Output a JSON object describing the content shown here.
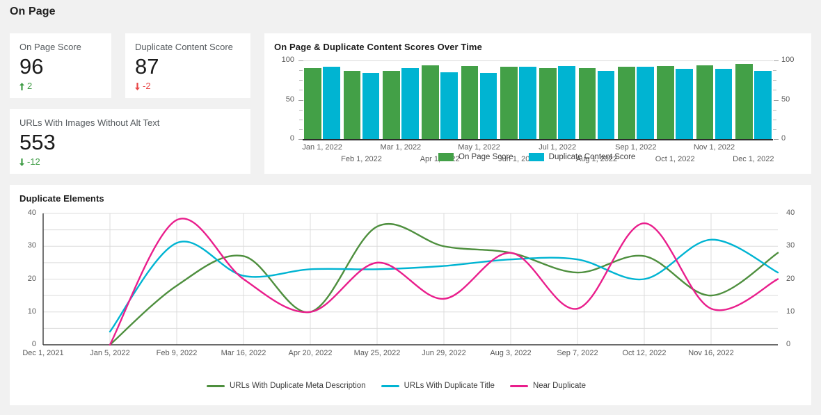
{
  "header": {
    "title": "On Page"
  },
  "kpis": [
    {
      "label": "On Page Score",
      "value": "96",
      "delta": "2",
      "direction": "up",
      "color": "#3f9c46"
    },
    {
      "label": "Duplicate Content Score",
      "value": "87",
      "delta": "-2",
      "direction": "down",
      "color": "#e84545"
    },
    {
      "label": "URLs With Images Without Alt Text",
      "value": "553",
      "delta": "-12",
      "direction": "down",
      "color": "#3f9c46"
    }
  ],
  "bar_panel": {
    "title": "On Page & Duplicate Content Scores Over Time"
  },
  "line_panel": {
    "title": "Duplicate Elements"
  },
  "chart_data": [
    {
      "type": "bar",
      "title": "On Page & Duplicate Content Scores Over Time",
      "xlabel": "",
      "ylabel": "",
      "ylim": [
        0,
        100
      ],
      "yticks": [
        0,
        50,
        100
      ],
      "dual_axis": true,
      "grid": true,
      "legend_position": "bottom",
      "categories": [
        "Jan 1, 2022",
        "Feb 1, 2022",
        "Mar 1, 2022",
        "Apr 1, 2022",
        "May 1, 2022",
        "Jun 1, 2022",
        "Jul 1, 2022",
        "Aug 1, 2022",
        "Sep 1, 2022",
        "Oct 1, 2022",
        "Nov 1, 2022",
        "Dec 1, 2022"
      ],
      "series": [
        {
          "name": "On Page Score",
          "color": "#43a047",
          "values": [
            90,
            87,
            87,
            94,
            93,
            92,
            90,
            90,
            92,
            93,
            94,
            96
          ]
        },
        {
          "name": "Duplicate Content Score",
          "color": "#00b4d2",
          "values": [
            92,
            84,
            90,
            85,
            84,
            92,
            93,
            87,
            92,
            89,
            89,
            87
          ]
        }
      ]
    },
    {
      "type": "line",
      "title": "Duplicate Elements",
      "xlabel": "",
      "ylabel": "",
      "ylim": [
        0,
        40
      ],
      "yticks": [
        0,
        10,
        20,
        30,
        40
      ],
      "dual_axis": true,
      "grid": true,
      "legend_position": "bottom",
      "x": [
        "Dec 1, 2021",
        "Jan 5, 2022",
        "Feb 9, 2022",
        "Mar 16, 2022",
        "Apr 20, 2022",
        "May 25, 2022",
        "Jun 29, 2022",
        "Aug 3, 2022",
        "Sep 7, 2022",
        "Oct 12, 2022",
        "Nov 16, 2022"
      ],
      "series": [
        {
          "name": "URLs With Duplicate Meta Description",
          "color": "#4e8f3e",
          "values": [
            null,
            0,
            18,
            27,
            10,
            36,
            30,
            28,
            22,
            27,
            15,
            28
          ]
        },
        {
          "name": "URLs With Duplicate Title",
          "color": "#00b4d2",
          "values": [
            null,
            4,
            31,
            21,
            23,
            23,
            24,
            26,
            26,
            20,
            32,
            22
          ]
        },
        {
          "name": "Near Duplicate",
          "color": "#e91e8c",
          "values": [
            null,
            0,
            38,
            20,
            10,
            25,
            14,
            28,
            11,
            37,
            11,
            20
          ]
        }
      ]
    }
  ]
}
